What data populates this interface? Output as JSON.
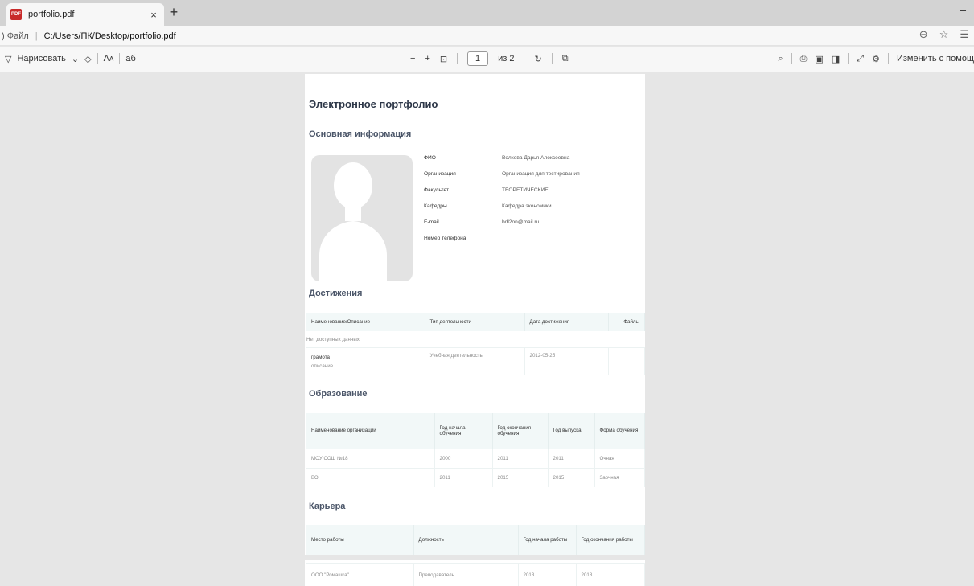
{
  "browser": {
    "tab_title": "portfolio.pdf",
    "tab_close": "×",
    "new_tab": "+",
    "minimize": "–",
    "address_proto": ") Файл",
    "address_url": "C:/Users/ПК/Desktop/portfolio.pdf"
  },
  "pdf_toolbar": {
    "draw_label": "Нарисовать",
    "read_aloud": "Aᴀ",
    "translit": "аб",
    "zoom_out": "−",
    "zoom_in": "+",
    "page_current": "1",
    "page_total": "из 2",
    "edit_label": "Изменить с помощ"
  },
  "document": {
    "title": "Электронное портфолио",
    "basic_info_heading": "Основная информация",
    "info_rows": [
      {
        "label": "ФИО",
        "value": "Волкова Дарья Алексеевна"
      },
      {
        "label": "Организация",
        "value": "Организация для тестирования"
      },
      {
        "label": "Факультет",
        "value": "ТЕОРЕТИЧЕСКИЕ"
      },
      {
        "label": "Кафедры",
        "value": "Кафедра экономики"
      },
      {
        "label": "E-mail",
        "value": "bdl2on@mail.ru"
      },
      {
        "label": "Номер телефона",
        "value": ""
      }
    ],
    "achievements_heading": "Достижения",
    "achievements_headers": [
      "Наименование/Описание",
      "Тип деятельности",
      "Дата достижения",
      "Файлы"
    ],
    "no_data": "Нет доступных данных",
    "achievements_rows": [
      {
        "name": "грамота",
        "desc": "описание",
        "type": "Учебная деятельность",
        "date": "2012-05-25",
        "files": ""
      }
    ],
    "education_heading": "Образование",
    "education_headers": [
      "Наименование организации",
      "Год начала обучения",
      "Год окончания обучения",
      "Год выпуска",
      "Форма обучения"
    ],
    "education_rows": [
      [
        "МОУ СОШ №18",
        "2000",
        "2011",
        "2011",
        "Очная"
      ],
      [
        "ВО",
        "2011",
        "2015",
        "2015",
        "Заочная"
      ]
    ],
    "career_heading": "Карьера",
    "career_headers": [
      "Место работы",
      "Должность",
      "Год начала работы",
      "Год окончания работы"
    ],
    "career_rows": [
      [
        "ООО \"Ромашка\"",
        "Преподаватель",
        "2013",
        "2018"
      ]
    ]
  }
}
